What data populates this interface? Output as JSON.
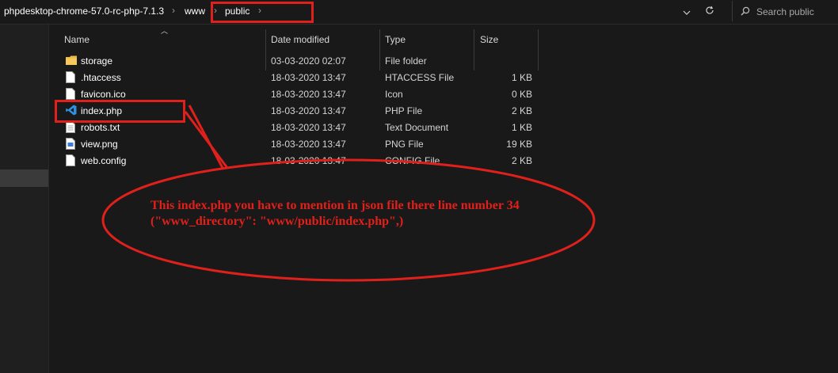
{
  "breadcrumb": {
    "items": [
      "phpdesktop-chrome-57.0-rc-php-7.1.3",
      "www",
      "public"
    ]
  },
  "search": {
    "placeholder": "Search public"
  },
  "columns": {
    "name": "Name",
    "date": "Date modified",
    "type": "Type",
    "size": "Size"
  },
  "files": [
    {
      "name": "storage",
      "date": "03-03-2020 02:07",
      "type": "File folder",
      "size": "",
      "icon": "folder-icon"
    },
    {
      "name": ".htaccess",
      "date": "18-03-2020 13:47",
      "type": "HTACCESS File",
      "size": "1 KB",
      "icon": "file-icon"
    },
    {
      "name": "favicon.ico",
      "date": "18-03-2020 13:47",
      "type": "Icon",
      "size": "0 KB",
      "icon": "file-icon"
    },
    {
      "name": "index.php",
      "date": "18-03-2020 13:47",
      "type": "PHP File",
      "size": "2 KB",
      "icon": "vscode-icon"
    },
    {
      "name": "robots.txt",
      "date": "18-03-2020 13:47",
      "type": "Text Document",
      "size": "1 KB",
      "icon": "text-file-icon"
    },
    {
      "name": "view.png",
      "date": "18-03-2020 13:47",
      "type": "PNG File",
      "size": "19 KB",
      "icon": "image-file-icon"
    },
    {
      "name": "web.config",
      "date": "18-03-2020 13:47",
      "type": "CONFIG File",
      "size": "2 KB",
      "icon": "file-icon"
    }
  ],
  "annotation": {
    "text": "This index.php you have to mention in json file there line number 34 (\"www_directory\": \"www/public/index.php\",)",
    "color": "#e0201b"
  }
}
